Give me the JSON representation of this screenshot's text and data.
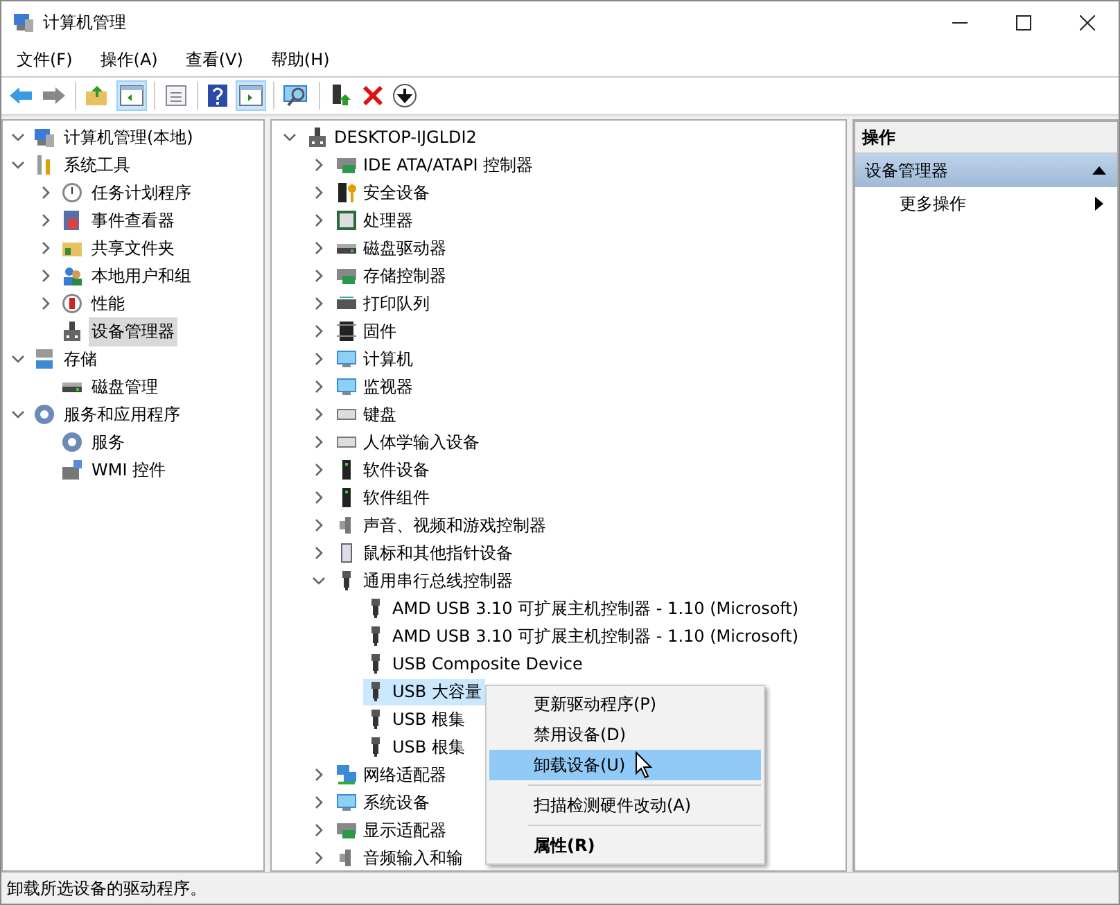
{
  "window": {
    "title": "计算机管理"
  },
  "menu_bar": [
    "文件(F)",
    "操作(A)",
    "查看(V)",
    "帮助(H)"
  ],
  "left_tree": [
    {
      "label": "计算机管理(本地)",
      "selected": false,
      "expanded": true,
      "children": [
        {
          "label": "系统工具",
          "selected": false,
          "expanded": true,
          "children": [
            {
              "label": "任务计划程序",
              "selected": false,
              "expanded": false
            },
            {
              "label": "事件查看器",
              "selected": false,
              "expanded": false
            },
            {
              "label": "共享文件夹",
              "selected": false,
              "expanded": false
            },
            {
              "label": "本地用户和组",
              "selected": false,
              "expanded": false
            },
            {
              "label": "性能",
              "selected": false,
              "expanded": false
            },
            {
              "label": "设备管理器",
              "selected": true
            }
          ]
        },
        {
          "label": "存储",
          "selected": false,
          "expanded": true,
          "children": [
            {
              "label": "磁盘管理",
              "selected": false
            }
          ]
        },
        {
          "label": "服务和应用程序",
          "selected": false,
          "expanded": true,
          "children": [
            {
              "label": "服务",
              "selected": false
            },
            {
              "label": "WMI 控件",
              "selected": false
            }
          ]
        }
      ]
    }
  ],
  "device_tree": [
    {
      "label": "DESKTOP-IJGLDI2",
      "selected": false,
      "expanded": true,
      "children": [
        {
          "label": "IDE ATA/ATAPI 控制器",
          "selected": false,
          "expanded": false
        },
        {
          "label": "安全设备",
          "selected": false,
          "expanded": false
        },
        {
          "label": "处理器",
          "selected": false,
          "expanded": false
        },
        {
          "label": "磁盘驱动器",
          "selected": false,
          "expanded": false
        },
        {
          "label": "存储控制器",
          "selected": false,
          "expanded": false
        },
        {
          "label": "打印队列",
          "selected": false,
          "expanded": false
        },
        {
          "label": "固件",
          "selected": false,
          "expanded": false
        },
        {
          "label": "计算机",
          "selected": false,
          "expanded": false
        },
        {
          "label": "监视器",
          "selected": false,
          "expanded": false
        },
        {
          "label": "键盘",
          "selected": false,
          "expanded": false
        },
        {
          "label": "人体学输入设备",
          "selected": false,
          "expanded": false
        },
        {
          "label": "软件设备",
          "selected": false,
          "expanded": false
        },
        {
          "label": "软件组件",
          "selected": false,
          "expanded": false
        },
        {
          "label": "声音、视频和游戏控制器",
          "selected": false,
          "expanded": false
        },
        {
          "label": "鼠标和其他指针设备",
          "selected": false,
          "expanded": false
        },
        {
          "label": "通用串行总线控制器",
          "selected": false,
          "expanded": true,
          "children": [
            {
              "label": "AMD USB 3.10 可扩展主机控制器 - 1.10 (Microsoft)",
              "selected": false
            },
            {
              "label": "AMD USB 3.10 可扩展主机控制器 - 1.10 (Microsoft)",
              "selected": false
            },
            {
              "label": "USB Composite Device",
              "selected": false
            },
            {
              "label": "USB 大容量",
              "selected": true
            },
            {
              "label": "USB 根集",
              "selected": false
            },
            {
              "label": "USB 根集",
              "selected": false
            }
          ]
        },
        {
          "label": "网络适配器",
          "selected": false,
          "expanded": false
        },
        {
          "label": "系统设备",
          "selected": false,
          "expanded": false
        },
        {
          "label": "显示适配器",
          "selected": false,
          "expanded": false
        },
        {
          "label": "音频输入和输",
          "selected": false,
          "expanded": false
        }
      ]
    }
  ],
  "actions_pane": {
    "header": "操作",
    "section": {
      "label": "设备管理器",
      "expanded": true
    },
    "items": [
      "更多操作"
    ]
  },
  "context_menu": [
    {
      "kind": "item",
      "label": "更新驱动程序(P)",
      "selected": false,
      "default": false
    },
    {
      "kind": "item",
      "label": "禁用设备(D)",
      "selected": false,
      "default": false
    },
    {
      "kind": "item",
      "label": "卸载设备(U)",
      "selected": true,
      "default": false
    },
    {
      "kind": "separator"
    },
    {
      "kind": "item",
      "label": "扫描检测硬件改动(A)",
      "selected": false,
      "default": false
    },
    {
      "kind": "separator"
    },
    {
      "kind": "item",
      "label": "属性(R)",
      "selected": false,
      "default": true
    }
  ],
  "status_bar": "卸载所选设备的驱动程序。"
}
